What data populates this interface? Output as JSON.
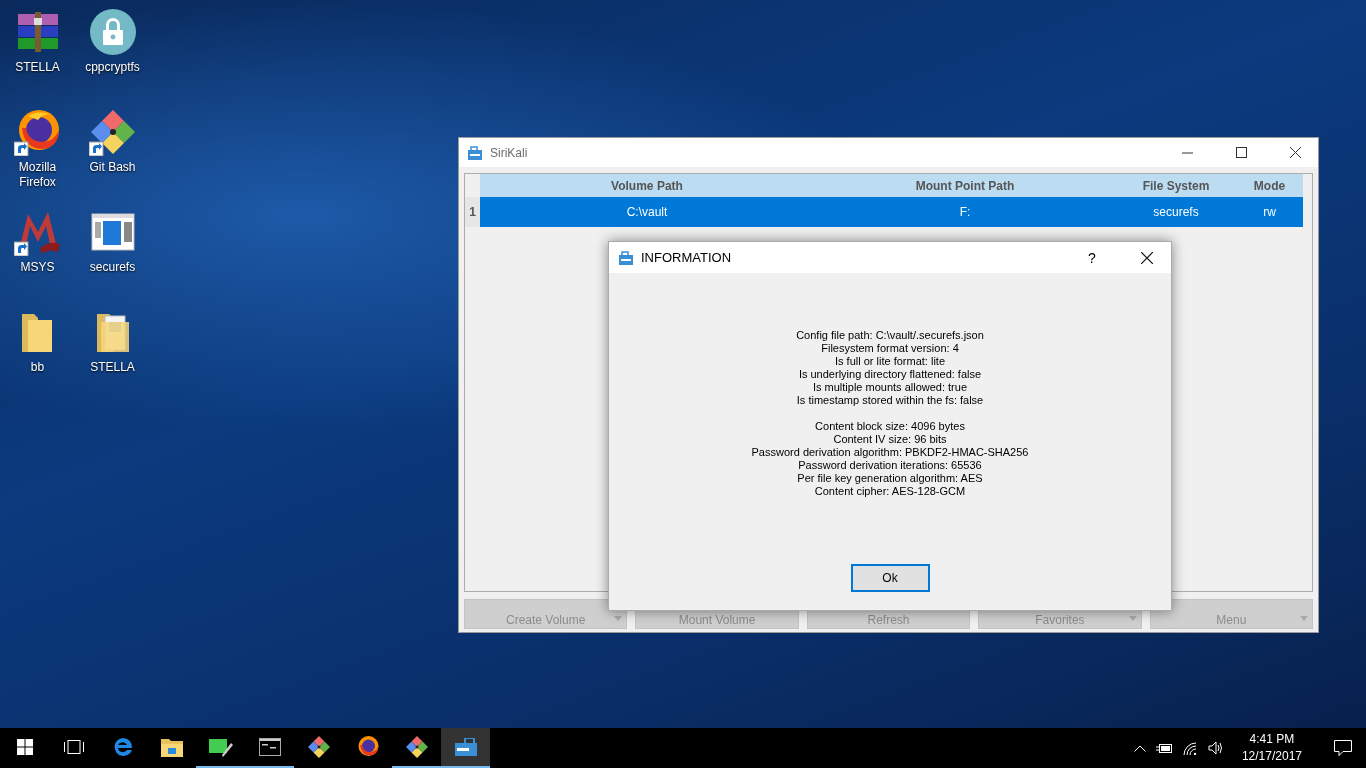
{
  "desktop_icons": [
    {
      "label": "STELLA",
      "kind": "archive",
      "shortcut": false
    },
    {
      "label": "cppcryptfs",
      "kind": "lock",
      "shortcut": false
    },
    {
      "label": "Mozilla Firefox",
      "kind": "firefox",
      "shortcut": true
    },
    {
      "label": "Git Bash",
      "kind": "git",
      "shortcut": true
    },
    {
      "label": "MSYS",
      "kind": "msys",
      "shortcut": true
    },
    {
      "label": "securefs",
      "kind": "app",
      "shortcut": false
    },
    {
      "label": "bb",
      "kind": "folder",
      "shortcut": false
    },
    {
      "label": "STELLA",
      "kind": "docs-folder",
      "shortcut": false
    }
  ],
  "main_window": {
    "title": "SiriKali",
    "table": {
      "columns": [
        "Volume Path",
        "Mount Point Path",
        "File System",
        "Mode"
      ],
      "rows": [
        {
          "number": "1",
          "cells": [
            "C:\\vault",
            "F:",
            "securefs",
            "rw"
          ],
          "selected": true
        }
      ]
    },
    "buttons": [
      {
        "label": "Create Volume",
        "has_menu": true,
        "disabled": true
      },
      {
        "label": "Mount Volume",
        "has_menu": false,
        "disabled": true
      },
      {
        "label": "Refresh",
        "has_menu": false,
        "disabled": true
      },
      {
        "label": "Favorites",
        "has_menu": true,
        "disabled": true
      },
      {
        "label": "Menu",
        "has_menu": true,
        "disabled": true
      }
    ]
  },
  "dialog": {
    "title": "INFORMATION",
    "help": "?",
    "groups": [
      [
        "Config file path: C:\\vault/.securefs.json",
        "Filesystem format version: 4",
        "Is full or lite format: lite",
        "Is underlying directory flattened: false",
        "Is multiple mounts allowed: true",
        "Is timestamp stored within the fs: false"
      ],
      [
        "Content block size: 4096 bytes",
        "Content IV size: 96 bits",
        "Password derivation algorithm: PBKDF2-HMAC-SHA256",
        "Password derivation iterations: 65536",
        "Per file key generation algorithm: AES",
        "Content cipher: AES-128-GCM"
      ]
    ],
    "ok_button": "Ok"
  },
  "taskbar": {
    "apps": [
      {
        "kind": "start",
        "running": false,
        "active": false
      },
      {
        "kind": "taskview",
        "running": false,
        "active": false
      },
      {
        "kind": "edge",
        "running": false,
        "active": false
      },
      {
        "kind": "explorer",
        "running": false,
        "active": false
      },
      {
        "kind": "qt",
        "running": true,
        "active": false
      },
      {
        "kind": "terminal",
        "running": true,
        "active": false
      },
      {
        "kind": "git",
        "running": false,
        "active": false
      },
      {
        "kind": "firefox",
        "running": false,
        "active": false
      },
      {
        "kind": "git",
        "running": true,
        "active": false
      },
      {
        "kind": "sirikali",
        "running": true,
        "active": true
      }
    ],
    "time": "4:41 PM",
    "date": "12/17/2017"
  }
}
